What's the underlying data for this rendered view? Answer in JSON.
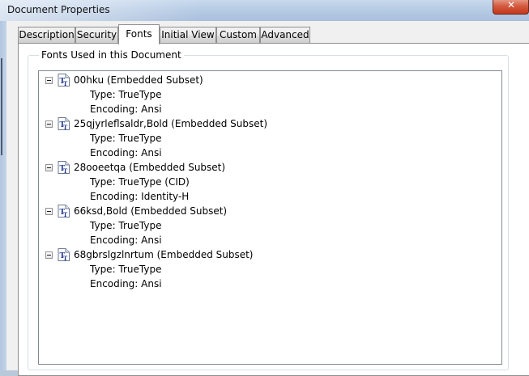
{
  "window": {
    "title": "Document Properties"
  },
  "tabs": [
    {
      "label": "Description",
      "active": false
    },
    {
      "label": "Security",
      "active": false
    },
    {
      "label": "Fonts",
      "active": true
    },
    {
      "label": "Initial View",
      "active": false
    },
    {
      "label": "Custom",
      "active": false
    },
    {
      "label": "Advanced",
      "active": false
    }
  ],
  "fonts_panel": {
    "group_title": "Fonts Used in this Document",
    "fonts": [
      {
        "name": "00hku (Embedded Subset)",
        "type": "Type: TrueType",
        "encoding": "Encoding: Ansi",
        "icon": "truetype-font-icon"
      },
      {
        "name": "25qjyrleflsaldr,Bold (Embedded Subset)",
        "type": "Type: TrueType",
        "encoding": "Encoding: Ansi",
        "icon": "truetype-font-icon"
      },
      {
        "name": "28ooeetqa (Embedded Subset)",
        "type": "Type: TrueType (CID)",
        "encoding": "Encoding: Identity-H",
        "icon": "truetype-font-icon"
      },
      {
        "name": "66ksd,Bold (Embedded Subset)",
        "type": "Type: TrueType",
        "encoding": "Encoding: Ansi",
        "icon": "truetype-font-icon"
      },
      {
        "name": "68gbrslgzlnrtum (Embedded Subset)",
        "type": "Type: TrueType",
        "encoding": "Encoding: Ansi",
        "icon": "truetype-font-icon"
      }
    ]
  },
  "colors": {
    "accent": "#1f3a93",
    "close_button": "#c2371c",
    "tab_border": "#8e8f8f"
  }
}
